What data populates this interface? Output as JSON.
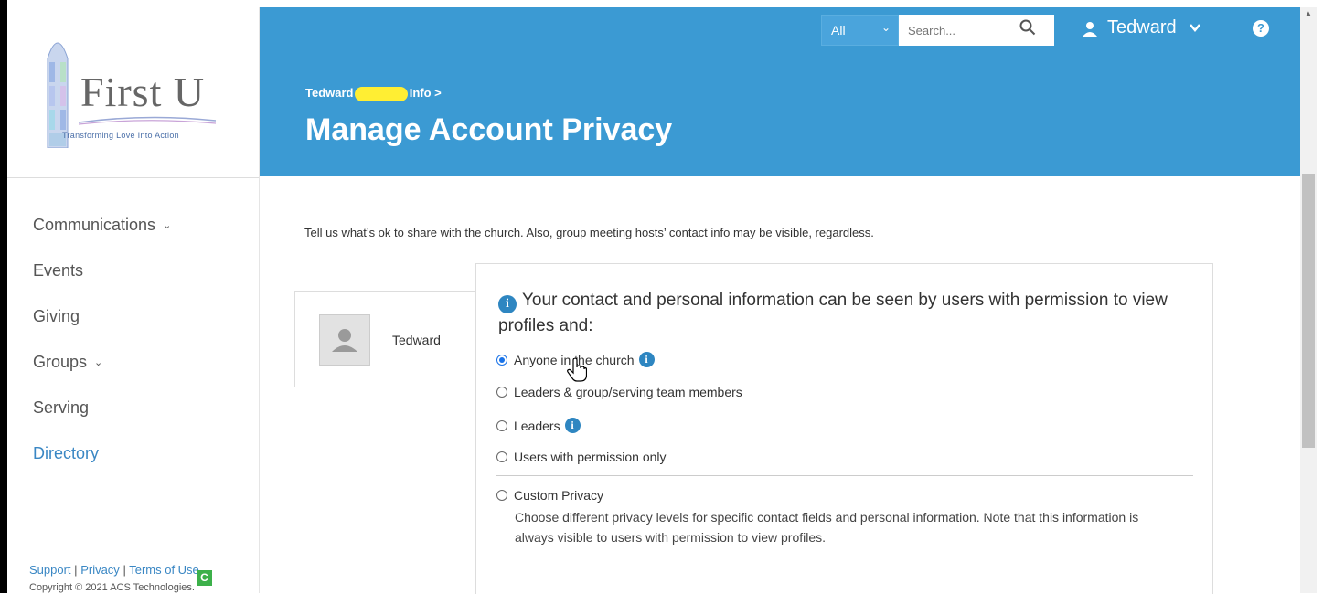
{
  "brand": {
    "logo_text": "First U",
    "tagline": "Transforming Love Into Action"
  },
  "sidebar": {
    "items": [
      {
        "label": "Communications",
        "has_dropdown": true
      },
      {
        "label": "Events",
        "has_dropdown": false
      },
      {
        "label": "Giving",
        "has_dropdown": false
      },
      {
        "label": "Groups",
        "has_dropdown": true
      },
      {
        "label": "Serving",
        "has_dropdown": false
      },
      {
        "label": "Directory",
        "has_dropdown": false,
        "active": true
      }
    ],
    "footer": {
      "support": "Support",
      "privacy": "Privacy",
      "terms": "Terms of Use",
      "copyright": "Copyright © 2021 ACS Technologies.",
      "badge": "C"
    }
  },
  "header": {
    "search_scope": "All",
    "search_placeholder": "Search...",
    "user_name": "Tedward",
    "help": "?",
    "breadcrumb_start": "Tedward",
    "breadcrumb_end": "Info >",
    "title": "Manage Account Privacy"
  },
  "main": {
    "intro": "Tell us what’s ok to share with the church. Also, group meeting hosts’ contact info may be visible, regardless.",
    "profile_name": "Tedward",
    "privacy_heading": "Your contact and personal information can be seen by users with permission to view profiles and:",
    "options": [
      {
        "label": "Anyone in the church",
        "checked": true,
        "info": true
      },
      {
        "label": "Leaders & group/serving team members",
        "checked": false,
        "info": false
      },
      {
        "label": "Leaders",
        "checked": false,
        "info": true
      },
      {
        "label": "Users with permission only",
        "checked": false,
        "info": false
      }
    ],
    "custom": {
      "label": "Custom Privacy",
      "description": "Choose different privacy levels for specific contact fields and personal information. Note that this information is always visible to users with permission to view profiles."
    }
  },
  "colors": {
    "header_bg": "#3b9ad3",
    "link": "#3a87c4",
    "info": "#2e86c1"
  }
}
